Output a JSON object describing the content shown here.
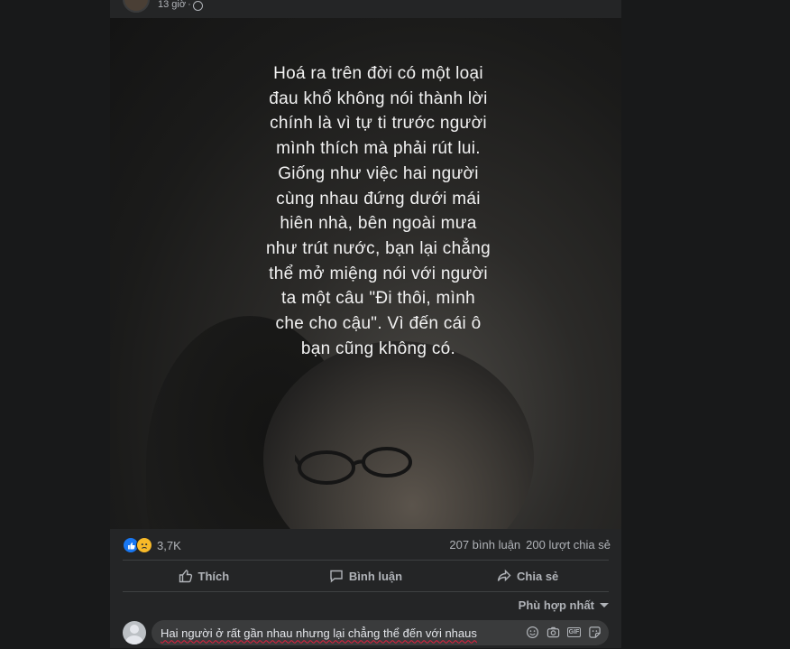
{
  "post": {
    "time": "13 giờ",
    "separator": "·",
    "privacy_icon": "globe-icon"
  },
  "image_text": {
    "lines": [
      "Hoá ra trên đời có một loại",
      "đau khổ không nói thành lời",
      "chính là vì tự ti trước người",
      "mình thích mà phải rút lui.",
      "Giống như việc hai người",
      "cùng nhau đứng dưới mái",
      "hiên nhà, bên ngoài mưa",
      "như trút nước, bạn lại chẳng",
      "thể mở miệng nói với người",
      "ta một câu \"Đi thôi, mình",
      "che cho cậu\". Vì đến cái ô",
      "bạn cũng không có."
    ]
  },
  "stats": {
    "reaction_icons": [
      "like-icon",
      "sad-icon"
    ],
    "reaction_count": "3,7K",
    "comments": "207 bình luận",
    "shares": "200 lượt chia sẻ"
  },
  "actions": {
    "like": "Thích",
    "comment": "Bình luận",
    "share": "Chia sẻ"
  },
  "sort": {
    "label": "Phù hợp nhất"
  },
  "comment_box": {
    "value": "Hai người ở rất gần nhau nhưng lại chẳng thể đến với nhaus",
    "tool_icons": [
      "emoji-icon",
      "camera-icon",
      "gif-icon",
      "sticker-icon"
    ]
  },
  "colors": {
    "page_bg": "#18191a",
    "card_bg": "#242526",
    "input_bg": "#3a3b3c",
    "secondary_text": "#b0b3b8",
    "like_blue": "#1877f2",
    "sad_yellow": "#f7b928"
  }
}
